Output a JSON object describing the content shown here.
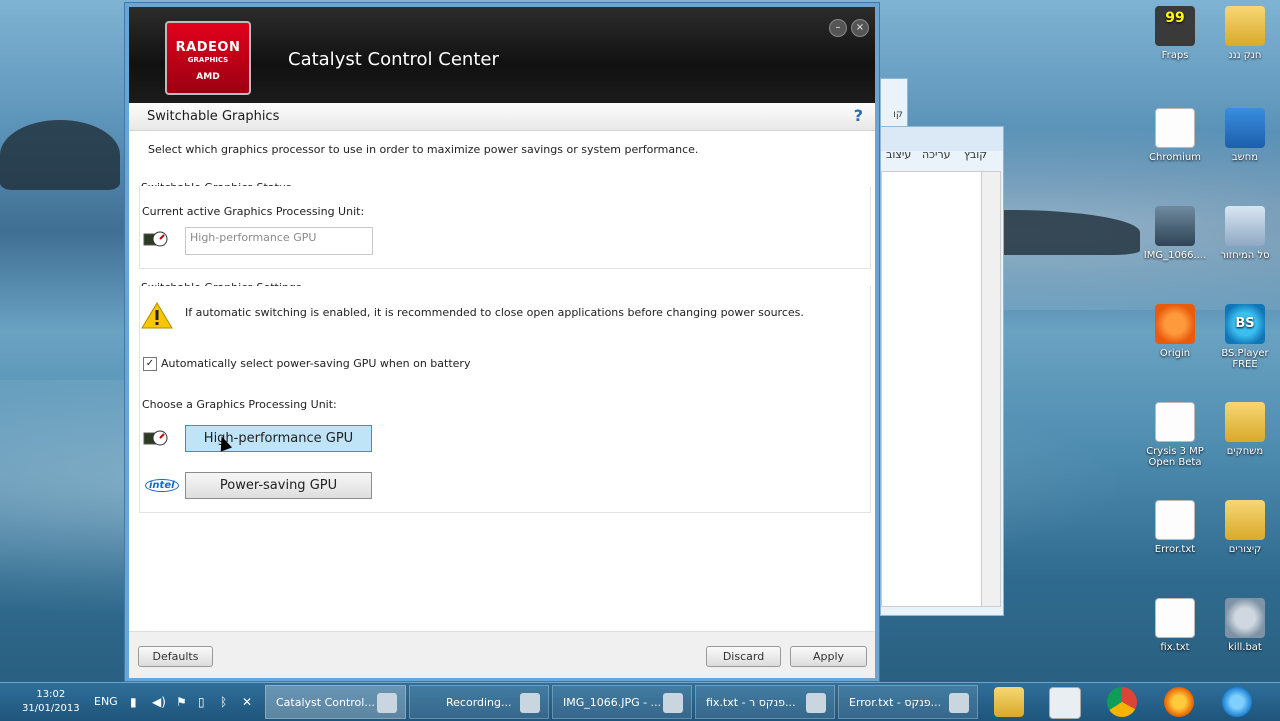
{
  "app": {
    "logo": {
      "line1": "RADEON",
      "line2": "GRAPHICS",
      "line3": "AMD"
    },
    "title": "Catalyst Control Center",
    "minimize": "–",
    "close": "×"
  },
  "section": {
    "title": "Switchable Graphics",
    "help": "?"
  },
  "description": "Select which graphics processor to use in order to maximize power savings or system performance.",
  "status": {
    "group_title": "Switchable Graphics Status",
    "current_label": "Current active Graphics Processing Unit:",
    "current_value": "High-performance GPU"
  },
  "settings": {
    "group_title": "Switchable Graphics Settings",
    "warning": "If automatic switching is enabled, it is recommended to close open applications before changing power sources.",
    "auto_checkbox_label": "Automatically select power-saving GPU when on battery",
    "auto_checked": true,
    "check_mark": "✓",
    "choose_label": "Choose a Graphics Processing Unit:",
    "high_perf_label": "High-performance GPU",
    "power_saving_label": "Power-saving GPU",
    "intel_logo": "intel"
  },
  "footer": {
    "defaults": "Defaults",
    "discard": "Discard",
    "apply": "Apply"
  },
  "background_window": {
    "menu": [
      "עיצוב",
      "עריכה",
      "קובץ"
    ],
    "title_fragment": "קו"
  },
  "desktop_icons": [
    {
      "label": "Fraps",
      "icon": "fraps-icon",
      "badge": "99"
    },
    {
      "label": "חנק נננ",
      "icon": "folder-icon"
    },
    {
      "label": "Chromium",
      "icon": "document-icon"
    },
    {
      "label": "מחשב",
      "icon": "computer-icon"
    },
    {
      "label": "IMG_1066....",
      "icon": "image-icon"
    },
    {
      "label": "סל המיחזור",
      "icon": "recycle-bin-icon"
    },
    {
      "label": "Origin",
      "icon": "origin-icon"
    },
    {
      "label": "BS.Player FREE",
      "icon": "bsplayer-icon",
      "badge": "BS"
    },
    {
      "label": "Crysis 3 MP Open Beta",
      "icon": "document-icon"
    },
    {
      "label": "משחקים",
      "icon": "folder-icon"
    },
    {
      "label": "Error.txt",
      "icon": "document-icon"
    },
    {
      "label": "קיצורים",
      "icon": "folder-icon"
    },
    {
      "label": "fix.txt",
      "icon": "document-icon"
    },
    {
      "label": "kill.bat",
      "icon": "gear-icon"
    }
  ],
  "taskbar": {
    "time": "13:02",
    "date": "31/01/2013",
    "language": "ENG",
    "tray_icons": [
      "signal-icon",
      "volume-icon",
      "flag-icon",
      "battery-icon",
      "bluetooth-icon",
      "network-error-icon"
    ],
    "buttons": [
      {
        "label": "Catalyst Control...",
        "active": true
      },
      {
        "label": "Recording...",
        "active": false
      },
      {
        "label": "IMG_1066.JPG - ...",
        "active": false
      },
      {
        "label": "fix.txt - פנקס ר...",
        "active": false
      },
      {
        "label": "Error.txt - פנקס...",
        "active": false
      }
    ],
    "pinned": [
      "file-explorer-icon",
      "window-icon",
      "chrome-icon",
      "firefox-icon",
      "internet-explorer-icon"
    ]
  }
}
